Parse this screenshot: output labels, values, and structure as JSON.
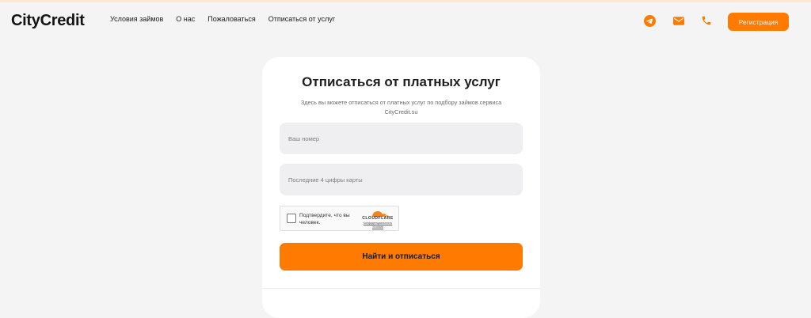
{
  "brand": {
    "logo": "CityCredit",
    "accent": "#ff7a00"
  },
  "nav": {
    "items": [
      {
        "label": "Условия займов"
      },
      {
        "label": "О нас"
      },
      {
        "label": "Пожаловаться"
      },
      {
        "label": "Отписаться от услуг"
      }
    ]
  },
  "header_icons": [
    "telegram-icon",
    "mail-icon",
    "phone-icon"
  ],
  "header": {
    "register_label": "Регистрация"
  },
  "form": {
    "title": "Отписаться от платных услуг",
    "description": "Здесь вы можете отписаться от платных услуг по подбору займов сервиса CityCredit.su",
    "phone_placeholder": "Ваш номер",
    "card_placeholder": "Последние 4 цифры карты",
    "submit_label": "Найти и отписаться"
  },
  "captcha": {
    "label": "Подтвердите, что вы человек.",
    "brand": "CLOUDFLARE",
    "privacy_link": "Конфиденциальность Условия"
  }
}
